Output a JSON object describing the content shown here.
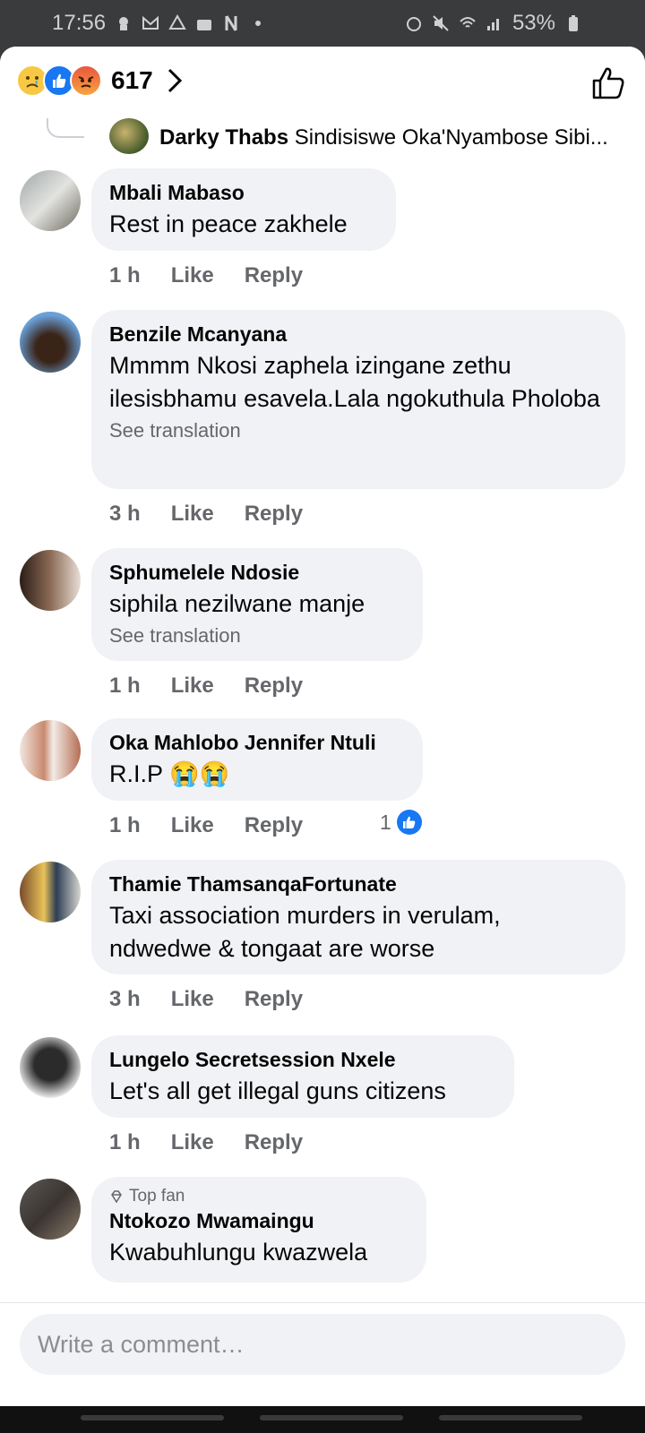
{
  "status_bar": {
    "time": "17:56",
    "battery": "53%"
  },
  "header": {
    "reaction_count": "617"
  },
  "previous_reply": {
    "name": "Darky Thabs",
    "text": "Sindisiswe Oka'Nyambose Sibi..."
  },
  "comments": [
    {
      "name": "Mbali Mabaso",
      "text": "Rest in peace zakhele",
      "time": "1 h"
    },
    {
      "name": "Benzile Mcanyana",
      "text": "Mmmm Nkosi zaphela izingane zethu ilesisbhamu esavela.Lala ngokuthula Pholoba",
      "see": "See translation",
      "time": "3 h"
    },
    {
      "name": "Sphumelele Ndosie",
      "text": "siphila nezilwane manje",
      "see": "See translation",
      "time": "1 h"
    },
    {
      "name": "Oka Mahlobo Jennifer Ntuli",
      "text": "R.I.P 😭😭",
      "time": "1 h",
      "reaction_count": "1"
    },
    {
      "name": "Thamie ThamsanqaFortunate",
      "text": "Taxi association murders in verulam, ndwedwe & tongaat are worse",
      "time": "3 h"
    },
    {
      "name": "Lungelo Secretsession Nxele",
      "text": "Let's all get illegal guns citizens",
      "time": "1 h"
    },
    {
      "badge": "Top fan",
      "name": "Ntokozo Mwamaingu",
      "text": "Kwabuhlungu kwazwela"
    }
  ],
  "actions": {
    "like": "Like",
    "reply": "Reply"
  },
  "composer": {
    "placeholder": "Write a comment…"
  },
  "colors": {
    "accent": "#1877f2",
    "bubble": "#f0f2f5",
    "muted": "#65676b"
  }
}
